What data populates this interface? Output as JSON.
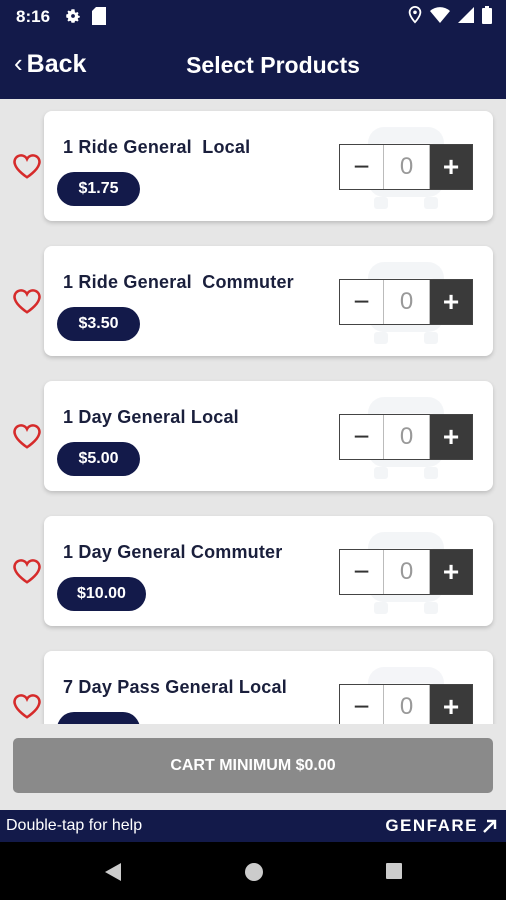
{
  "status_bar": {
    "time": "8:16",
    "left_icons": [
      "gear-icon",
      "sd-card-icon"
    ],
    "right_icons": [
      "location-icon",
      "wifi-icon",
      "signal-icon",
      "battery-icon"
    ]
  },
  "header": {
    "back_label": "Back",
    "title": "Select Products"
  },
  "products": [
    {
      "name": "1 Ride General  Local",
      "price": "$1.75",
      "quantity": "0"
    },
    {
      "name": "1 Ride General  Commuter",
      "price": "$3.50",
      "quantity": "0"
    },
    {
      "name": "1 Day General Local",
      "price": "$5.00",
      "quantity": "0"
    },
    {
      "name": "1 Day General Commuter",
      "price": "$10.00",
      "quantity": "0"
    },
    {
      "name": "7 Day Pass General Local",
      "price": "",
      "quantity": "0"
    }
  ],
  "stepper": {
    "minus": "−",
    "plus": "+"
  },
  "cart_button": {
    "label": "CART MINIMUM $0.00"
  },
  "help_bar": {
    "text": "Double-tap for help",
    "brand": "GENFARE"
  },
  "colors": {
    "navy": "#131a4a",
    "heart": "#d62b2b",
    "cart_disabled": "#8a8a8a"
  },
  "nav": {
    "buttons": [
      "back-triangle-icon",
      "home-circle-icon",
      "recents-square-icon"
    ]
  }
}
